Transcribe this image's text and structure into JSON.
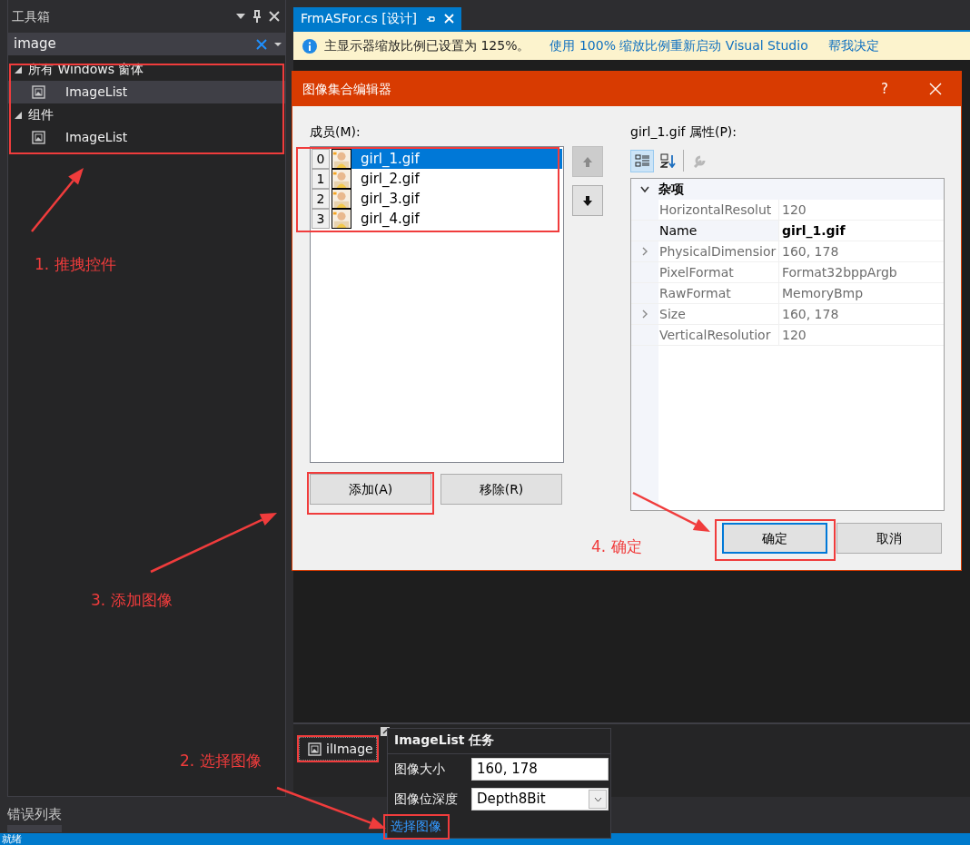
{
  "toolbox": {
    "title": "工具箱",
    "search": {
      "value": "image"
    },
    "groups": [
      {
        "label": "所有 Windows 窗体",
        "expanded": true,
        "children": [
          {
            "label": "ImageList",
            "selected": true
          }
        ]
      },
      {
        "label": "组件",
        "expanded": true,
        "children": [
          {
            "label": "ImageList",
            "selected": false
          }
        ]
      }
    ]
  },
  "tabs": [
    {
      "label": "FrmASFor.cs [设计]",
      "selected": true
    }
  ],
  "info_bar": {
    "message": "主显示器缩放比例已设置为 125%。",
    "links": [
      "使用 100% 缩放比例重新启动 Visual Studio",
      "帮我决定"
    ]
  },
  "dialog": {
    "title": "图像集合编辑器",
    "help": "?",
    "members_label": "成员(M):",
    "members": [
      {
        "index": "0",
        "name": "girl_1.gif",
        "selected": true
      },
      {
        "index": "1",
        "name": "girl_2.gif",
        "selected": false
      },
      {
        "index": "2",
        "name": "girl_3.gif",
        "selected": false
      },
      {
        "index": "3",
        "name": "girl_4.gif",
        "selected": false
      }
    ],
    "move_up": {
      "disabled": true
    },
    "move_down": {
      "disabled": false
    },
    "add": "添加(A)",
    "remove": "移除(R)",
    "properties_label": "girl_1.gif 属性(P):",
    "toolbar": [
      {
        "kind": "categorized",
        "selected": true,
        "disabled": false
      },
      {
        "kind": "alphabetical",
        "selected": false,
        "disabled": false
      },
      {
        "kind": "property-pages",
        "selected": false,
        "disabled": true
      }
    ],
    "category": {
      "label": "杂项",
      "expanded": true,
      "rows": [
        {
          "name": "HorizontalResolut",
          "value": "120",
          "expandable": false,
          "selected": false,
          "bold": false
        },
        {
          "name": "Name",
          "value": "girl_1.gif",
          "expandable": false,
          "selected": true,
          "bold": true
        },
        {
          "name": "PhysicalDimensior",
          "value": "160, 178",
          "expandable": true,
          "selected": false,
          "bold": false
        },
        {
          "name": "PixelFormat",
          "value": "Format32bppArgb",
          "expandable": false,
          "selected": false,
          "bold": false
        },
        {
          "name": "RawFormat",
          "value": "MemoryBmp",
          "expandable": false,
          "selected": false,
          "bold": false
        },
        {
          "name": "Size",
          "value": "160, 178",
          "expandable": true,
          "selected": false,
          "bold": false
        },
        {
          "name": "VerticalResolutior",
          "value": "120",
          "expandable": false,
          "selected": false,
          "bold": false
        }
      ]
    },
    "ok": {
      "label": "确定",
      "default": true
    },
    "cancel": {
      "label": "取消",
      "default": false
    }
  },
  "tray": {
    "component": "ilImage",
    "smart_tag": {
      "title": "ImageList 任务",
      "fields": [
        {
          "kind": "text",
          "label": "图像大小",
          "value": "160, 178"
        },
        {
          "kind": "select",
          "label": "图像位深度",
          "value": "Depth8Bit"
        }
      ],
      "link": "选择图像"
    }
  },
  "error_list": {
    "title": "错误列表"
  },
  "status_bar": {
    "text": "就绪"
  },
  "annotations": [
    {
      "text": "1. 推拽控件"
    },
    {
      "text": "3. 添加图像"
    },
    {
      "text": "2. 选择图像"
    },
    {
      "text": "4. 确定"
    }
  ]
}
